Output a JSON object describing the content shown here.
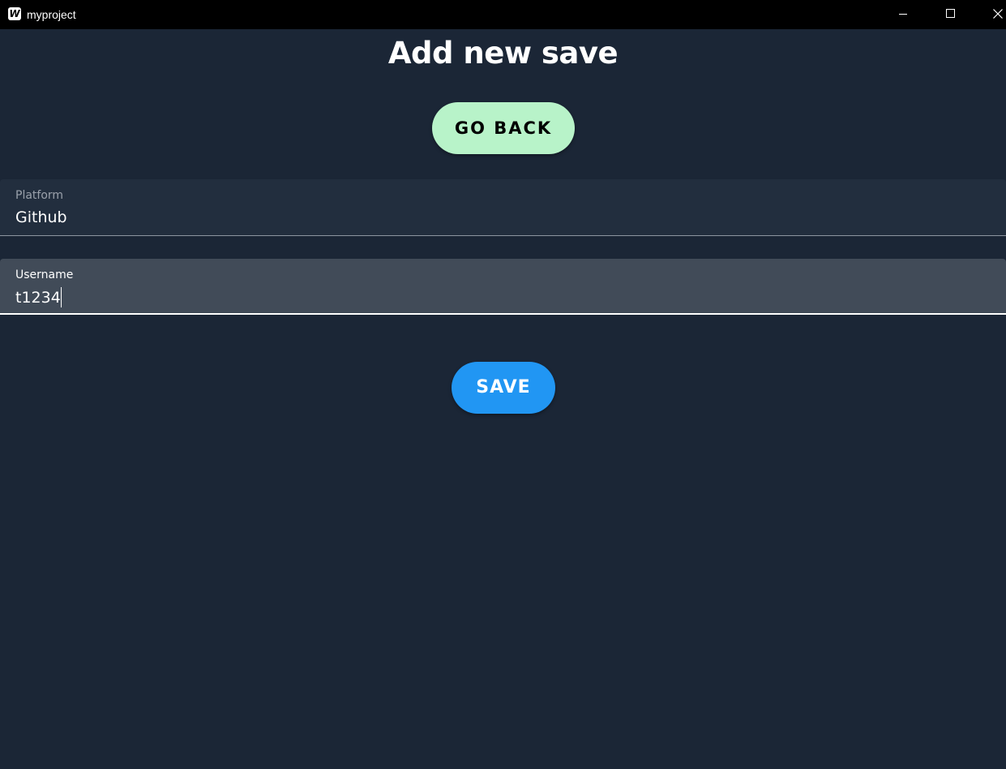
{
  "window": {
    "title": "myproject",
    "app_icon_letter": "W",
    "controls": {
      "minimize_icon": "minimize-icon",
      "maximize_icon": "maximize-icon",
      "close_icon": "close-icon"
    }
  },
  "page": {
    "title": "Add new save",
    "go_back_label": "GO BACK",
    "save_label": "SAVE"
  },
  "form": {
    "platform": {
      "label": "Platform",
      "value": "Github"
    },
    "username": {
      "label": "Username",
      "value": "t1234"
    }
  },
  "colors": {
    "background": "#1b2636",
    "go_back_button": "#b8f3c9",
    "save_button": "#2196f3",
    "focused_field": "#414b58",
    "field": "#222e3e"
  }
}
